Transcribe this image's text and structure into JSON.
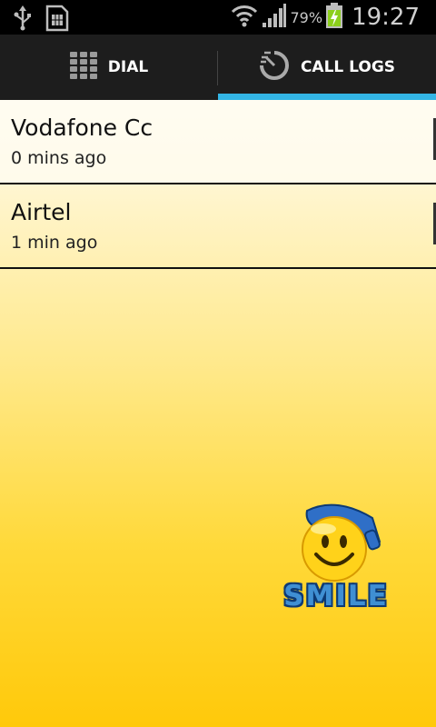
{
  "status_bar": {
    "battery_percent": "79%",
    "time": "19:27",
    "icons": [
      "usb-icon",
      "sim-card-icon",
      "wifi-icon",
      "signal-icon",
      "battery-charging-icon"
    ]
  },
  "tabs": [
    {
      "label": "DIAL",
      "icon": "keypad-icon",
      "selected": false
    },
    {
      "label": "CALL LOGS",
      "icon": "call-log-icon",
      "selected": true
    }
  ],
  "call_logs": [
    {
      "name": "Vodafone Cc",
      "time": "0 mins ago"
    },
    {
      "name": "Airtel",
      "time": "1 min ago"
    }
  ],
  "logo": {
    "text": "SMILE"
  },
  "colors": {
    "accent": "#33b5e5",
    "tabbar": "#1d1d1d",
    "logo_blue": "#3f8fd3"
  }
}
